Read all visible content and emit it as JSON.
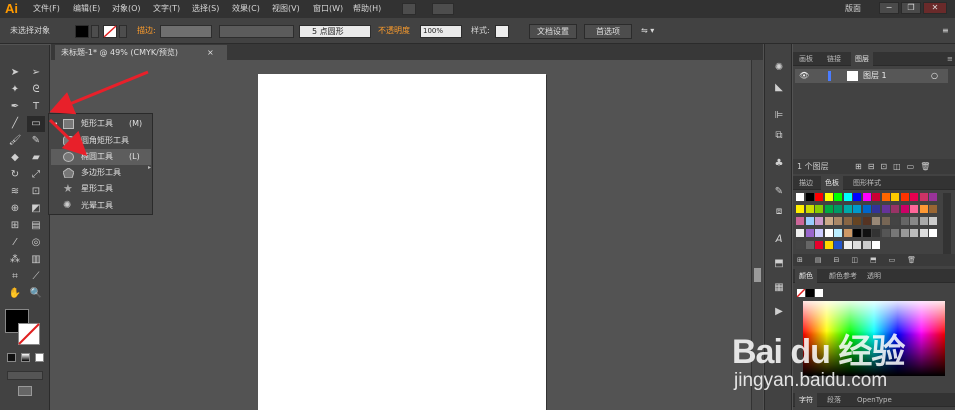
{
  "app": {
    "logo": "Ai",
    "workspace": "版面"
  },
  "menu": [
    {
      "label": "文件(F)"
    },
    {
      "label": "编辑(E)"
    },
    {
      "label": "对象(O)"
    },
    {
      "label": "文字(T)"
    },
    {
      "label": "选择(S)"
    },
    {
      "label": "效果(C)"
    },
    {
      "label": "视图(V)"
    },
    {
      "label": "窗口(W)"
    },
    {
      "label": "帮助(H)"
    }
  ],
  "control": {
    "no_selection": "未选择对象",
    "stroke_label": "描边:",
    "brush_value": "5 点圆形",
    "opacity_label": "不透明度",
    "opacity_value": "100%",
    "style_label": "样式:",
    "doc_setup_button": "文档设置",
    "preferences_button": "首选项"
  },
  "document": {
    "tab_title": "未标题-1* @ 49% (CMYK/预览)",
    "close": "×"
  },
  "flyout": {
    "items": [
      {
        "label": "矩形工具",
        "key": "(M)",
        "icon": "rectangle-icon"
      },
      {
        "label": "圆角矩形工具",
        "key": "",
        "icon": "rounded-rectangle-icon"
      },
      {
        "label": "椭圆工具",
        "key": "(L)",
        "icon": "ellipse-icon"
      },
      {
        "label": "多边形工具",
        "key": "",
        "icon": "polygon-icon"
      },
      {
        "label": "星形工具",
        "key": "",
        "icon": "star-icon"
      },
      {
        "label": "光晕工具",
        "key": "",
        "icon": "flare-icon"
      }
    ]
  },
  "layers_panel": {
    "tabs": [
      "画板",
      "链接",
      "图层"
    ],
    "layer_name": "图层 1",
    "footer": "1 个图层"
  },
  "swatches_panel": {
    "tabs": [
      "描边",
      "色板",
      "图形样式"
    ]
  },
  "color_panel": {
    "tabs": [
      "颜色",
      "颜色参考",
      "透明"
    ]
  },
  "character_panel": {
    "tabs": [
      "字符",
      "段落",
      "OpenType"
    ]
  },
  "watermark": {
    "brand": "Bai du 经验",
    "url": "jingyan.baidu.com"
  },
  "colors": {
    "accent": "#ff9a00",
    "arrow": "#e8202a",
    "artboard": "#ffffff"
  }
}
